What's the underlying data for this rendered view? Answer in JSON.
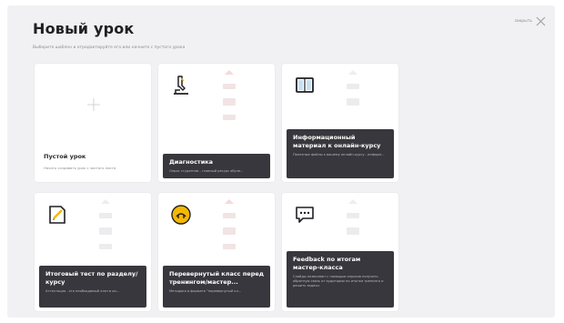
{
  "header": {
    "title": "Новый урок",
    "subtitle": "Выберите шаблон и отредактируйте его или начните с пустого урока",
    "close_label": "закрыть"
  },
  "empty_card": {
    "title": "Пустой урок",
    "description": "Начать создавать урок с чистого листа"
  },
  "templates": [
    {
      "title": "Диагностика",
      "description": "Опрос студентов - главный ресурс обуче...",
      "icon": "microscope-icon"
    },
    {
      "title": "Информационный материал к онлайн-курсу",
      "description": "Полезные файлы к вашему онлайн-курсу - информ...",
      "icon": "book-icon"
    },
    {
      "title": "Итоговый тест по разделу/курсу",
      "description": "Аттестация - это необходимый этап в ки...",
      "icon": "test-notepad-icon"
    },
    {
      "title": "Перевернутый класс перед тренингом/мастер...",
      "description": "Методика в формате \"перевернутый кл...",
      "icon": "face-icon"
    },
    {
      "title": "Feedback по итогам мастер-класса",
      "description": "Слайды позволяют с помощью опросов получить обратную связь от аудитории по итогам тренинга и решить задачи.",
      "icon": "chat-bubble-icon"
    }
  ],
  "colors": {
    "panel_bg": "#f1f1f3",
    "card_bg": "#ffffff",
    "footer_bg": "#37373d",
    "accent_yellow": "#f5b800"
  }
}
